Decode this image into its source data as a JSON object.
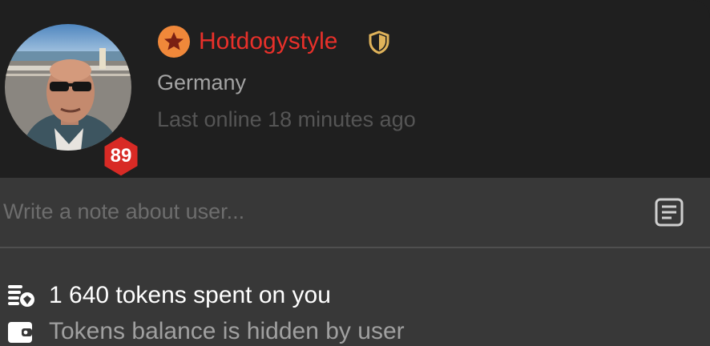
{
  "profile": {
    "username": "Hotdogystyle",
    "country": "Germany",
    "last_online": "Last online 18 minutes ago",
    "level": "89",
    "username_color": "#e8302a",
    "star_badge_color": "#f0883a",
    "shield_color": "#e0b35a",
    "level_badge_color": "#d82a25"
  },
  "note": {
    "placeholder": "Write a note about user...",
    "value": ""
  },
  "stats": {
    "tokens_spent": "1 640 tokens spent on you",
    "tokens_balance": "Tokens balance is hidden by user"
  },
  "icons": {
    "star": "star-icon",
    "shield": "shield-icon",
    "note": "note-icon",
    "coins": "coins-icon",
    "wallet": "wallet-icon"
  }
}
